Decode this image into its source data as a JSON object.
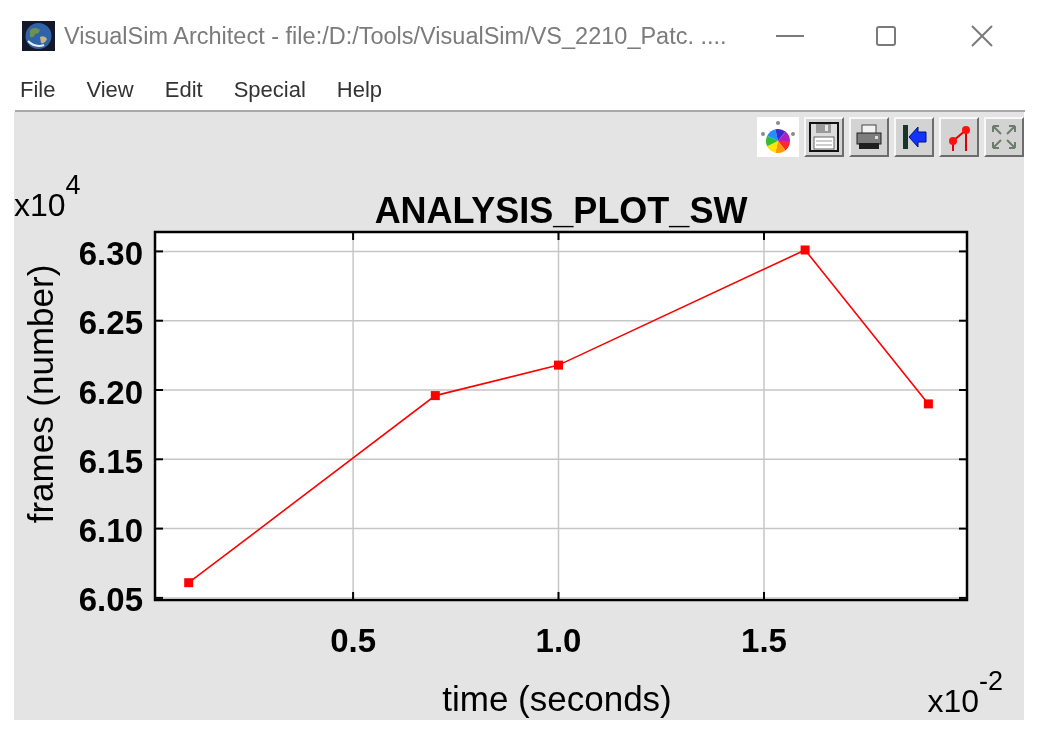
{
  "window": {
    "title": "VisualSim Architect - file:/D:/Tools/VisualSim/VS_2210_Patc. ....",
    "controls": [
      {
        "kind": "minimize"
      },
      {
        "kind": "maximize"
      },
      {
        "kind": "close"
      }
    ]
  },
  "menu": [
    "File",
    "View",
    "Edit",
    "Special",
    "Help"
  ],
  "toolbar": [
    {
      "kind": "wheel"
    },
    {
      "kind": "floppy"
    },
    {
      "kind": "printer"
    },
    {
      "kind": "arrow"
    },
    {
      "kind": "graph"
    },
    {
      "kind": "expand"
    }
  ],
  "plot": {
    "y_multiplier": "x10$^{4}$",
    "x_multiplier": "x10$^{-2}$",
    "chart_data": {
      "type": "line",
      "title": "ANALYSIS_PLOT_SW",
      "xlabel": "time (seconds)",
      "ylabel": "frames (number)",
      "grid": true,
      "x": [
        0.1,
        0.7,
        1.0,
        1.6,
        1.9
      ],
      "series": [
        {
          "color": "#ff0000",
          "marker": "square",
          "values": [
            6.061,
            6.196,
            6.218,
            6.301,
            6.19
          ]
        }
      ],
      "xlim": [
        0.018,
        1.994
      ],
      "ylim": [
        6.0485,
        6.314
      ],
      "xticks": [
        {
          "value": 0.5,
          "label": "0.5"
        },
        {
          "value": 1.0,
          "label": "1.0"
        },
        {
          "value": 1.5,
          "label": "1.5"
        }
      ],
      "yticks": [
        {
          "value": 6.05,
          "label": "6.05"
        },
        {
          "value": 6.1,
          "label": "6.10"
        },
        {
          "value": 6.15,
          "label": "6.15"
        },
        {
          "value": 6.2,
          "label": "6.20"
        },
        {
          "value": 6.25,
          "label": "6.25"
        },
        {
          "value": 6.3,
          "label": "6.30"
        }
      ]
    }
  }
}
